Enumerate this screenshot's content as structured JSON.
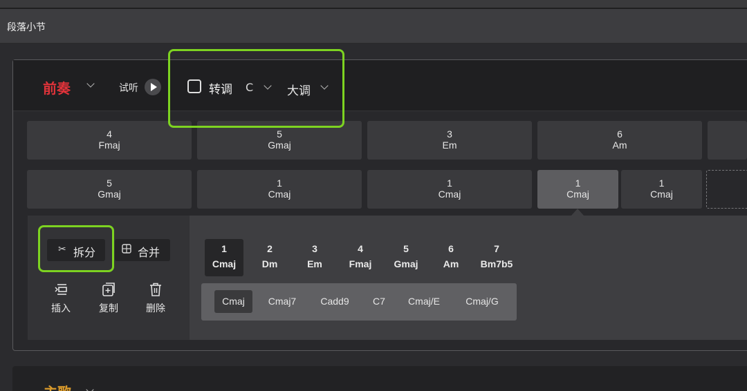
{
  "window": {
    "title": "段落小节"
  },
  "section": {
    "name": "前奏",
    "name_color": "#e0333a",
    "listen_label": "试听",
    "transpose_label": "转调",
    "transpose_checked": false,
    "key": "C",
    "mode": "大调"
  },
  "rows": [
    [
      {
        "degree": "4",
        "chord": "Fmaj"
      },
      {
        "degree": "5",
        "chord": "Gmaj"
      },
      {
        "degree": "3",
        "chord": "Em"
      },
      {
        "degree": "6",
        "chord": "Am"
      }
    ],
    [
      {
        "degree": "5",
        "chord": "Gmaj"
      },
      {
        "degree": "1",
        "chord": "Cmaj"
      },
      {
        "degree": "1",
        "chord": "Cmaj"
      },
      {
        "degree": "1",
        "chord": "Cmaj",
        "selected": true
      },
      {
        "degree": "1",
        "chord": "Cmaj"
      }
    ]
  ],
  "tools": {
    "split": "拆分",
    "merge": "合并",
    "insert": "插入",
    "copy": "复制",
    "delete": "删除"
  },
  "chord_picker": [
    {
      "degree": "1",
      "chord": "Cmaj",
      "selected": true
    },
    {
      "degree": "2",
      "chord": "Dm"
    },
    {
      "degree": "3",
      "chord": "Em"
    },
    {
      "degree": "4",
      "chord": "Fmaj"
    },
    {
      "degree": "5",
      "chord": "Gmaj"
    },
    {
      "degree": "6",
      "chord": "Am"
    },
    {
      "degree": "7",
      "chord": "Bm7b5"
    }
  ],
  "variants": [
    {
      "label": "Cmaj",
      "selected": true
    },
    {
      "label": "Cmaj7"
    },
    {
      "label": "Cadd9"
    },
    {
      "label": "C7"
    },
    {
      "label": "Cmaj/E"
    },
    {
      "label": "Cmaj/G"
    }
  ],
  "next_section": {
    "name": "主歌",
    "name_color": "#d99a2b"
  },
  "icons": {
    "scissors": "scissors-icon",
    "merge": "merge-icon",
    "insert": "insert-icon",
    "copy": "copy-icon",
    "delete": "trash-icon",
    "play": "play-icon",
    "chevron": "chevron-down-icon"
  },
  "highlight_color": "#7dd321"
}
